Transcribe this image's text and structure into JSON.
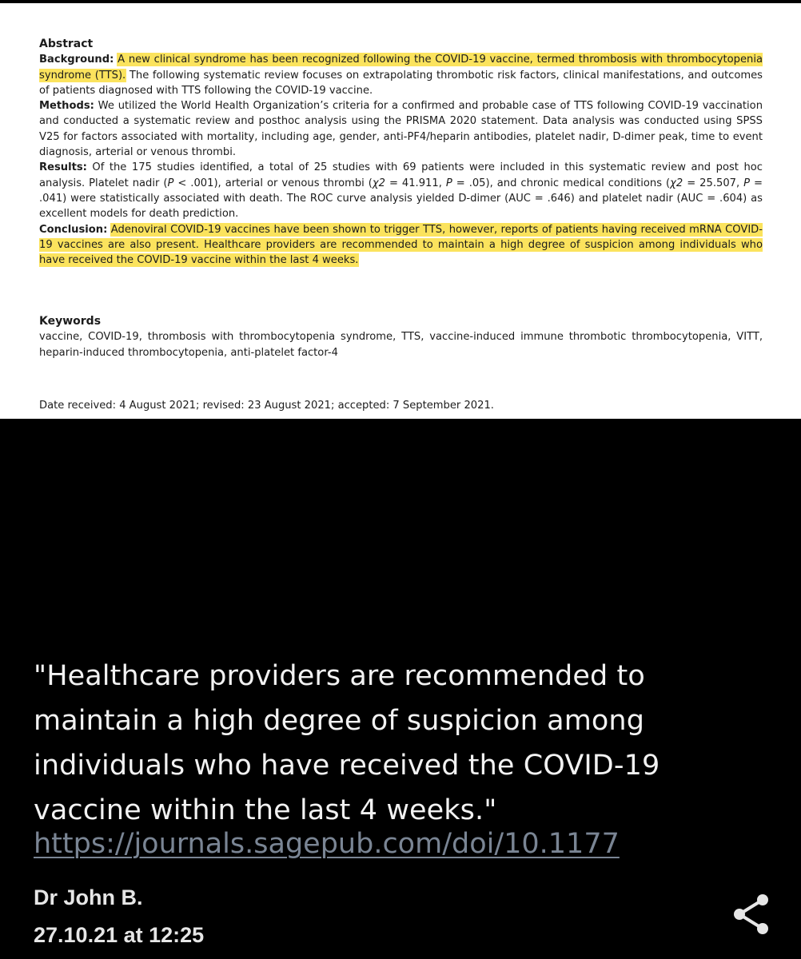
{
  "abstract": {
    "heading": "Abstract",
    "background_label": "Background:",
    "background_highlight": "A new clinical syndrome has been recognized following the COVID-19 vaccine, termed thrombosis with thrombocytopenia syndrome (TTS).",
    "background_rest": " The following systematic review focuses on extrapolating thrombotic risk factors, clinical manifestations, and outcomes of patients diagnosed with TTS following the COVID-19 vaccine.",
    "methods_label": "Methods:",
    "methods_text": " We utilized the World Health Organization’s criteria for a confirmed and probable case of TTS following COVID-19 vaccination and conducted a systematic review and posthoc analysis using the PRISMA 2020 statement. Data analysis was conducted using SPSS V25 for factors associated with mortality, including age, gender, anti-PF4/heparin antibodies, platelet nadir, D-dimer peak, time to event diagnosis, arterial or venous thrombi.",
    "results_label": "Results:",
    "results_text_1": " Of the 175 studies identified, a total of 25 studies with 69 patients were included in this systematic review and post hoc analysis. Platelet nadir (",
    "results_p1": "P",
    "results_text_2": " < .001), arterial or venous thrombi (",
    "results_chi1": "χ2",
    "results_text_3": " = 41.911, ",
    "results_p2": "P",
    "results_text_4": " = .05), and chronic medical conditions (",
    "results_chi2": "χ2",
    "results_text_5": " = 25.507, ",
    "results_p3": "P",
    "results_text_6": " = .041) were statistically associated with death. The ROC curve analysis yielded D-dimer (AUC = .646) and platelet nadir (AUC = .604) as excellent models for death prediction.",
    "conclusion_label": "Conclusion:",
    "conclusion_highlight": "Adenoviral COVID-19 vaccines have been shown to trigger TTS, however, reports of patients having received mRNA COVID-19 vaccines are also present. Healthcare providers are recommended to maintain a high degree of suspicion among individuals who have received the COVID-19 vaccine within the last 4 weeks."
  },
  "keywords": {
    "heading": "Keywords",
    "text": "vaccine, COVID-19, thrombosis with thrombocytopenia syndrome, TTS, vaccine-induced immune thrombotic thrombocytopenia, VITT, heparin-induced thrombocytopenia, anti-platelet factor-4"
  },
  "dates": "Date received: 4 August 2021; revised: 23 August 2021; accepted: 7 September 2021.",
  "caption": "\"Healthcare providers are recommended to maintain a high degree of suspicion among individuals who have received the COVID-19 vaccine within the last 4 weeks.\"",
  "link": "https://journals.sagepub.com/doi/10.1177",
  "author": "Dr John B.",
  "timestamp": "27.10.21 at 12:25",
  "icons": {
    "share": "share-icon"
  },
  "colors": {
    "highlight": "#fbe35d",
    "background": "#000000",
    "link": "#7a8594"
  }
}
